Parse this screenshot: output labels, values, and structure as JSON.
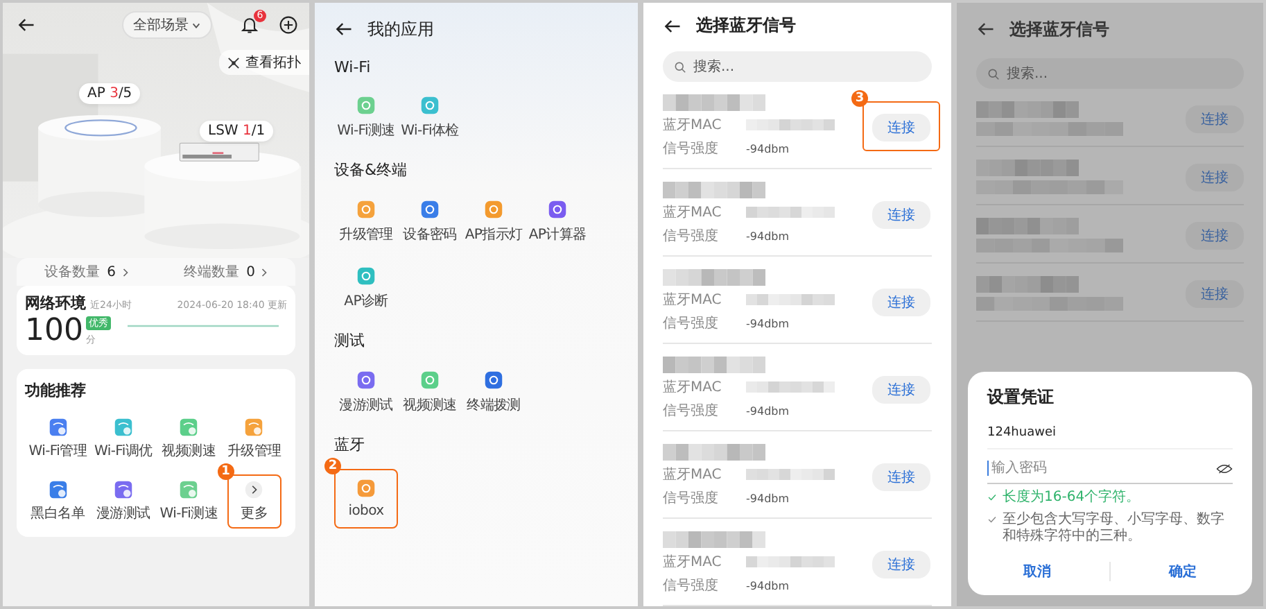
{
  "home": {
    "scene": "全部场景",
    "notification_count": "6",
    "topology": "查看拓扑",
    "devices": [
      {
        "name": "AP",
        "count": "3",
        "total": "/5"
      },
      {
        "name": "LSW",
        "count": "1",
        "total": "/1"
      }
    ],
    "stats": [
      {
        "label": "设备数量",
        "value": "6"
      },
      {
        "label": "终端数量",
        "value": "0"
      }
    ],
    "network": {
      "title": "网络环境",
      "period": "近24小时",
      "updated": "2024-06-20 18:40 更新",
      "score": "100",
      "grade": "优秀",
      "unit": "分"
    },
    "features": {
      "title": "功能推荐",
      "items": [
        {
          "kind": "app",
          "label": "Wi-Fi管理",
          "color": "#4a7ff0",
          "highlighted": false
        },
        {
          "kind": "app",
          "label": "Wi-Fi调优",
          "color": "#3bbfcf",
          "highlighted": false
        },
        {
          "kind": "app",
          "label": "视频测速",
          "color": "#5ccf8a",
          "highlighted": false
        },
        {
          "kind": "app",
          "label": "升级管理",
          "color": "#f5a23c",
          "highlighted": false
        },
        {
          "kind": "app",
          "label": "黑白名单",
          "color": "#3a7ee8",
          "highlighted": false
        },
        {
          "kind": "app",
          "label": "漫游测试",
          "color": "#7a6cf0",
          "highlighted": false
        },
        {
          "kind": "app",
          "label": "Wi-Fi测速",
          "color": "#6cd08f",
          "highlighted": false
        },
        {
          "kind": "more",
          "label": "更多",
          "highlighted": true,
          "callout": "1"
        }
      ]
    }
  },
  "my_apps": {
    "title": "我的应用",
    "sections": [
      {
        "title": "Wi-Fi",
        "apps": [
          {
            "label": "Wi-Fi测速",
            "color": "#6cd08f",
            "highlighted": false
          },
          {
            "label": "Wi-Fi体检",
            "color": "#3bbfcf",
            "highlighted": false
          }
        ]
      },
      {
        "title": "设备&终端",
        "apps": [
          {
            "label": "升级管理",
            "color": "#f5a23c",
            "highlighted": false
          },
          {
            "label": "设备密码",
            "color": "#3a7ee8",
            "highlighted": false
          },
          {
            "label": "AP指示灯",
            "color": "#f39a2e",
            "highlighted": false
          },
          {
            "label": "AP计算器",
            "color": "#7a5cf0",
            "highlighted": false
          },
          {
            "label": "AP诊断",
            "color": "#2fbfc0",
            "highlighted": false
          }
        ]
      },
      {
        "title": "测试",
        "apps": [
          {
            "label": "漫游测试",
            "color": "#7a6cf0",
            "highlighted": false
          },
          {
            "label": "视频测速",
            "color": "#5ccf8a",
            "highlighted": false
          },
          {
            "label": "终端拨测",
            "color": "#2f6fe0",
            "highlighted": false
          }
        ]
      },
      {
        "title": "蓝牙",
        "apps": [
          {
            "label": "iobox",
            "color": "#f59a3a",
            "highlighted": true,
            "callout": "2"
          }
        ]
      }
    ]
  },
  "bluetooth": {
    "title": "选择蓝牙信号",
    "search_placeholder": "搜索...",
    "devices": [
      {
        "mac_label": "蓝牙MAC",
        "signal_label": "信号强度",
        "signal": "-94dbm",
        "action": "连接",
        "highlighted": true,
        "callout": "3"
      },
      {
        "mac_label": "蓝牙MAC",
        "signal_label": "信号强度",
        "signal": "-94dbm",
        "action": "连接",
        "highlighted": false
      },
      {
        "mac_label": "蓝牙MAC",
        "signal_label": "信号强度",
        "signal": "-94dbm",
        "action": "连接",
        "highlighted": false
      },
      {
        "mac_label": "蓝牙MAC",
        "signal_label": "信号强度",
        "signal": "-94dbm",
        "action": "连接",
        "highlighted": false
      },
      {
        "mac_label": "蓝牙MAC",
        "signal_label": "信号强度",
        "signal": "-94dbm",
        "action": "连接",
        "highlighted": false
      },
      {
        "mac_label": "蓝牙MAC",
        "signal_label": "信号强度",
        "signal": "-94dbm",
        "action": "连接",
        "highlighted": false
      }
    ]
  },
  "credential": {
    "title": "选择蓝牙信号",
    "search_placeholder": "搜索...",
    "actions": [
      "连接",
      "连接",
      "连接",
      "连接"
    ],
    "dialog": {
      "title": "设置凭证",
      "username": "124huawei",
      "password_placeholder": "输入密码",
      "rules": [
        {
          "text": "长度为16-64个字符。",
          "met": true
        },
        {
          "text": "至少包含大写字母、小写字母、数字和特殊字符中的三种。",
          "met": false
        }
      ],
      "buttons": [
        "取消",
        "确定"
      ]
    }
  }
}
